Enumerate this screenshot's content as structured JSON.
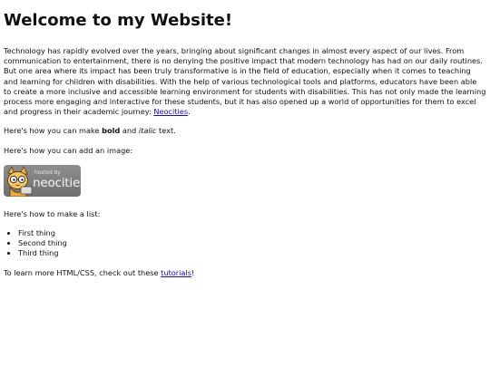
{
  "header": {
    "title": "Welcome to my Website!"
  },
  "intro": {
    "text": "Technology has rapidly evolved over the years, bringing about significant changes in almost every aspect of our lives. From communication to entertainment, there is no denying the positive impact that modern technology has had on our daily routines. But one area where its impact has been truly transformative is in the field of education, especially when it comes to teaching and learning for children with disabilities. With the help of various technological tools and platforms, educators have been able to create a more inclusive and accessible learning environment for students with disabilities. This has not only made the learning process more engaging and interactive for these students, but it has also opened up a world of opportunities for them to excel and progress in their academic journey: ",
    "link_label": "Neocities",
    "after_link": "."
  },
  "formatting": {
    "prefix": "Here's how you can make ",
    "bold": "bold",
    "middle": " and ",
    "italic": "italic",
    "suffix": " text."
  },
  "image_section": {
    "label": "Here's how you can add an image:",
    "badge_small": "hosted by",
    "badge_large": "neocities"
  },
  "list_section": {
    "label": "Here's how to make a list:",
    "items": [
      "First thing",
      "Second thing",
      "Third thing"
    ]
  },
  "footer": {
    "prefix": "To learn more HTML/CSS, check out these ",
    "link_label": "tutorials",
    "suffix": "!"
  },
  "colors": {
    "link": "#1a0dab",
    "badge_bg": "#7f7f7f",
    "text": "#111111"
  },
  "icons": {
    "badge_mascot": "cat-mascot-icon"
  }
}
